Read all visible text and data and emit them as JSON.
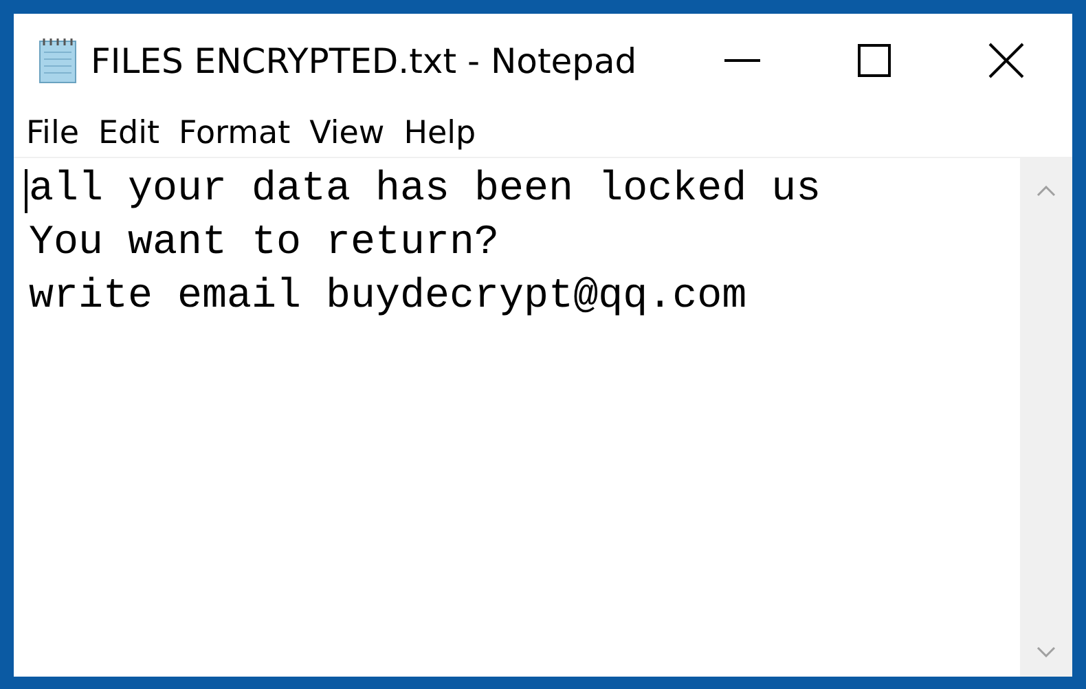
{
  "window": {
    "title": "FILES ENCRYPTED.txt - Notepad"
  },
  "menu": [
    "File",
    "Edit",
    "Format",
    "View",
    "Help"
  ],
  "document": {
    "lines": [
      "all your data has been locked us",
      "You want to return?",
      "write email buydecrypt@qq.com"
    ]
  }
}
